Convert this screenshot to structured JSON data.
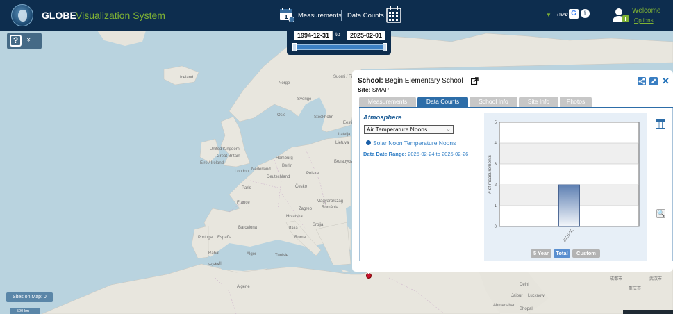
{
  "app": {
    "brand": "GLOBE",
    "subtitle": "Visualization System",
    "nav_measurements": "Measurements",
    "nav_data_counts": "Data Counts",
    "lang_arrow": "▼",
    "lang_label": "בחר שפה",
    "info_glyph": "i",
    "google_glyph": "G",
    "welcome": "Welcome",
    "options": "Options"
  },
  "date_range": {
    "start": "1994-12-31",
    "to": "to",
    "end": "2025-02-01",
    "slider_start_fraction": 0.0,
    "slider_end_fraction": 1.0
  },
  "help": {
    "glyph": "?",
    "chevron": "»"
  },
  "sites_on_map": "Sites on Map: 0",
  "scale": "500 km",
  "map_labels": [
    "Iceland",
    "Norge",
    "Sverige",
    "Suomi / Finland",
    "Oslo",
    "Stockholm",
    "Eesti",
    "Latvija",
    "Lietuva",
    "United Kingdom",
    "Great Britain",
    "Éire / Ireland",
    "London",
    "Nederland",
    "Hamburg",
    "Berlin",
    "Deutschland",
    "Polska",
    "Беларусь",
    "Paris",
    "Česko",
    "France",
    "Magyarország",
    "Zagreb",
    "România",
    "Hrvatska",
    "Srbija",
    "Italia",
    "Roma",
    "Barcelona",
    "España",
    "Portugal",
    "Rabat",
    "Alger",
    "المغرب",
    "Tunisie",
    "Algérie",
    "Delhi",
    "Jaipur",
    "Lucknow",
    "Ahmedabad",
    "Bhopal",
    "成都市",
    "重庆市",
    "武汉市"
  ],
  "sea_labels": [],
  "popup": {
    "school_label": "School:",
    "school_name": "Begin Elementary School",
    "site_label": "Site:",
    "site_name": "SMAP",
    "close_glyph": "✕",
    "tabs": [
      "Measurements",
      "Data Counts",
      "School Info",
      "Site Info",
      "Photos"
    ],
    "active_tab": "Data Counts",
    "section": "Atmosphere",
    "dropdown_value": "Air Temperature Noons",
    "dropdown_arrow": "⌵",
    "radio_label": "Solar Noon Temperature Noons",
    "range_label": "Data Date Range:",
    "range_value": "2025-02-24 to 2025-02-26",
    "range_buttons": [
      "5 Year",
      "Total",
      "Custom"
    ],
    "active_range_button": "Total",
    "zoom_glyph": "🔍"
  },
  "chart_data": {
    "type": "bar",
    "categories": [
      "2025-02"
    ],
    "values": [
      2
    ],
    "ylabel": "# of measurements",
    "ylim": [
      0,
      5
    ],
    "yticks": [
      0,
      1,
      2,
      3,
      4,
      5
    ],
    "bar_color": "#6f8fbd",
    "grid": true
  },
  "colors": {
    "header": "#0d2d4e",
    "accent_green": "#7fb234",
    "active_tab": "#2d6da8",
    "link_blue": "#2d7cc4"
  }
}
